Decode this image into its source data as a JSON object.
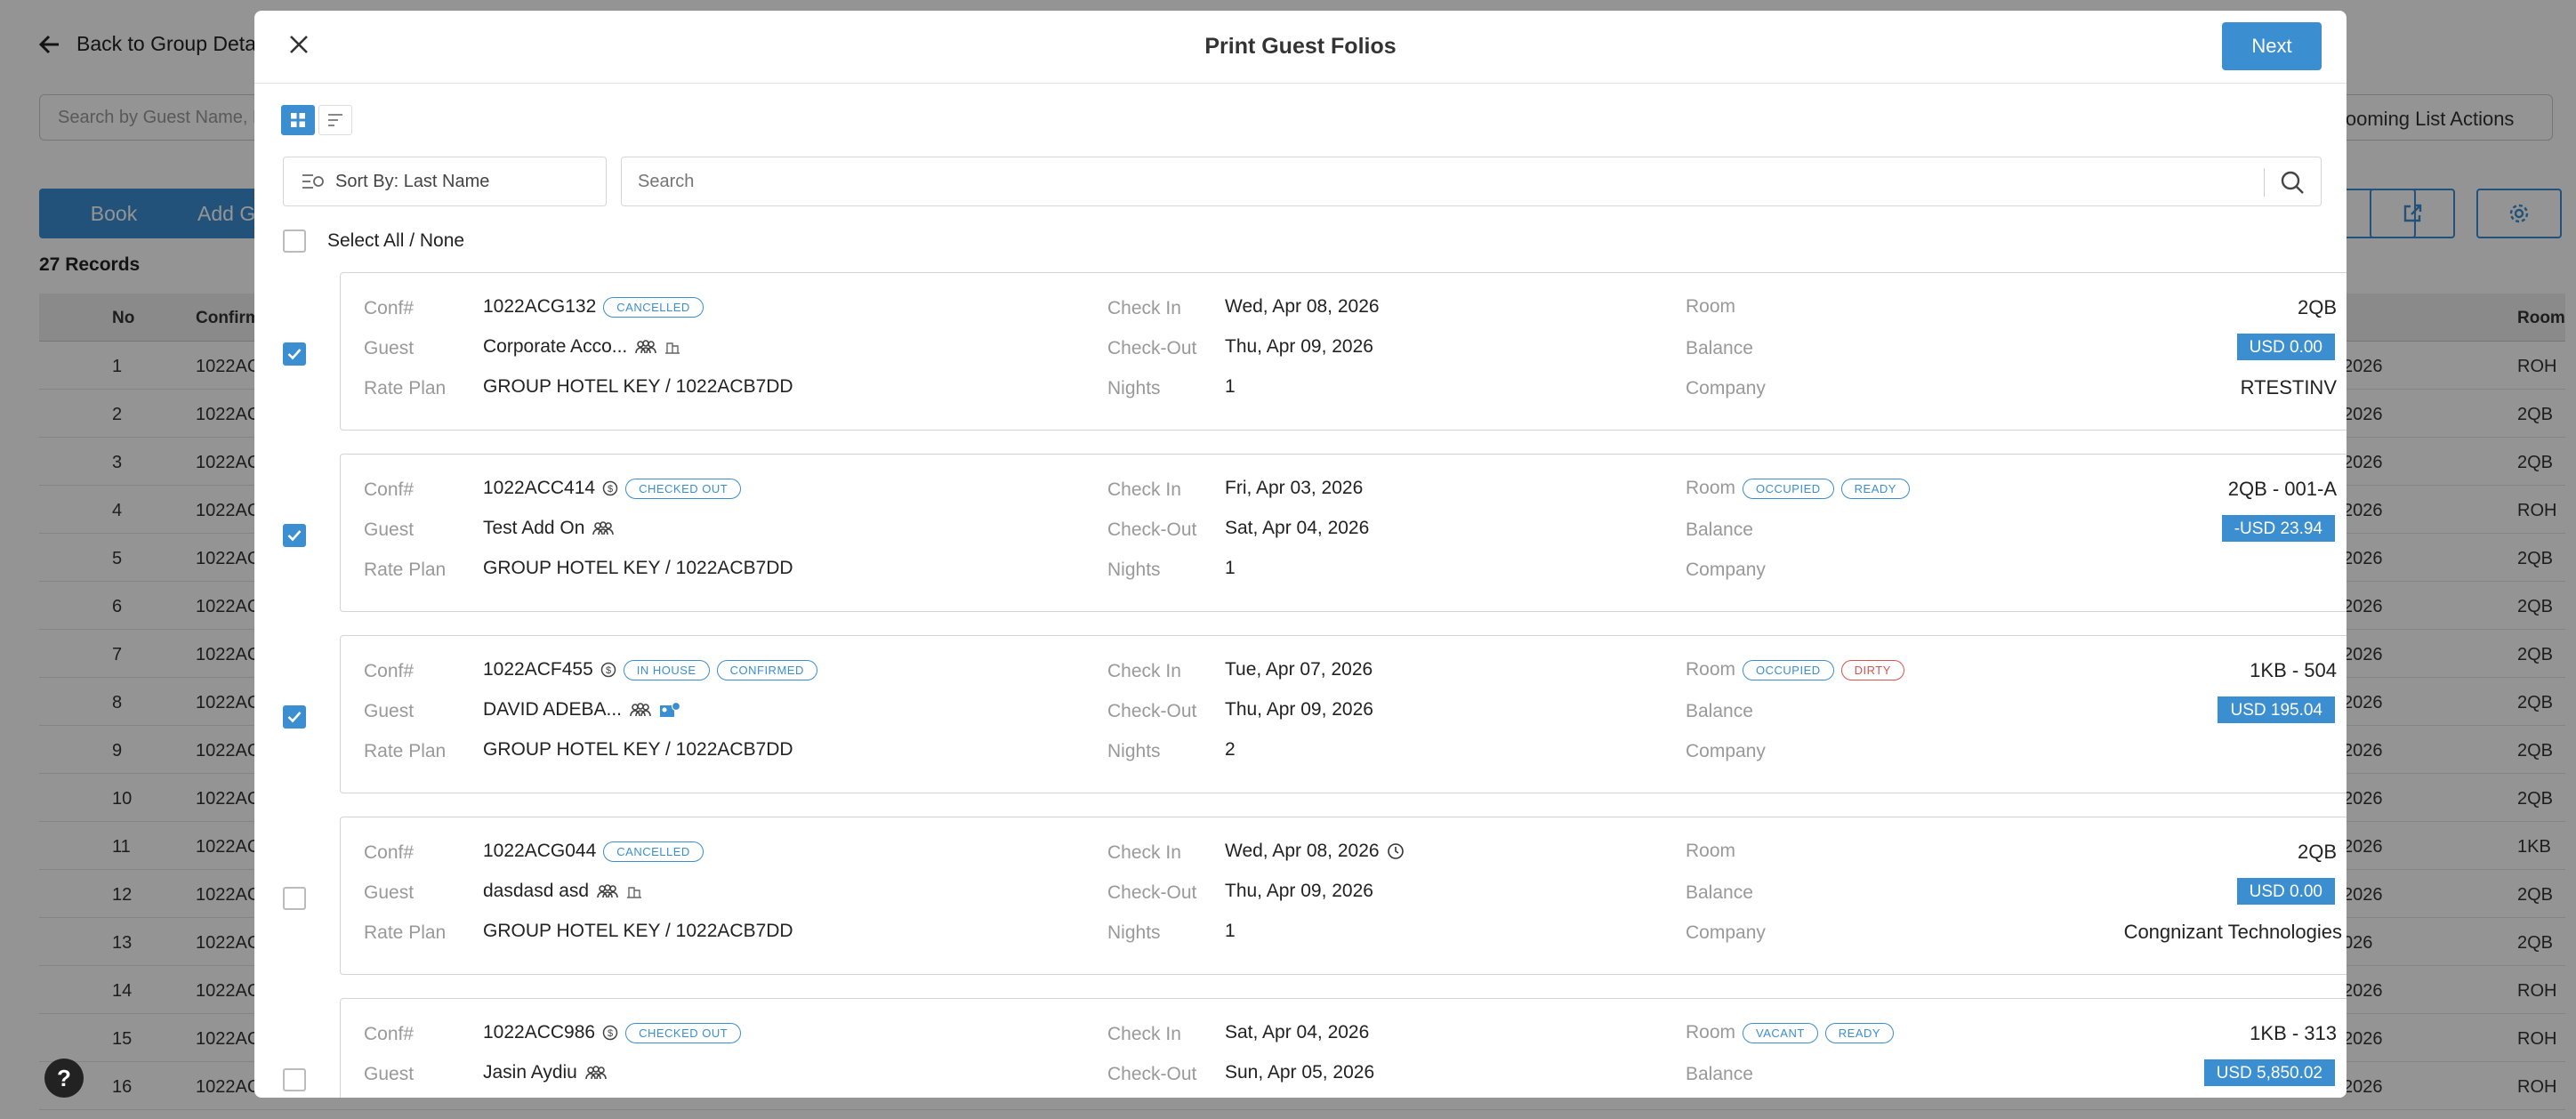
{
  "background": {
    "back_label": "Back to Group Details",
    "search_placeholder": "Search by Guest Name, Re",
    "rooming_actions_label": "Rooming List Actions",
    "book_label": "Book",
    "add_label": "Add G",
    "records_label": "27 Records",
    "columns": [
      "No",
      "Confirm",
      "",
      "Room"
    ],
    "rows": [
      {
        "no": "1",
        "conf": "1022AC",
        "date": "2026",
        "room": "ROH"
      },
      {
        "no": "2",
        "conf": "1022AC",
        "date": "2026",
        "room": "2QB"
      },
      {
        "no": "3",
        "conf": "1022AC",
        "date": "2026",
        "room": "2QB"
      },
      {
        "no": "4",
        "conf": "1022AC",
        "date": "2026",
        "room": "ROH"
      },
      {
        "no": "5",
        "conf": "1022AC",
        "date": "2026",
        "room": "2QB"
      },
      {
        "no": "6",
        "conf": "1022AC",
        "date": "2026",
        "room": "2QB"
      },
      {
        "no": "7",
        "conf": "1022AC",
        "date": "2026",
        "room": "2QB"
      },
      {
        "no": "8",
        "conf": "1022AC",
        "date": "2026",
        "room": "2QB"
      },
      {
        "no": "9",
        "conf": "1022AC",
        "date": "2026",
        "room": "2QB"
      },
      {
        "no": "10",
        "conf": "1022AC",
        "date": "2026",
        "room": "2QB"
      },
      {
        "no": "11",
        "conf": "1022AC",
        "date": "2026",
        "room": "1KB"
      },
      {
        "no": "12",
        "conf": "1022AC",
        "date": "2026",
        "room": "2QB"
      },
      {
        "no": "13",
        "conf": "1022AC",
        "date": "026",
        "room": "2QB"
      },
      {
        "no": "14",
        "conf": "1022AC",
        "date": "2026",
        "room": "ROH"
      },
      {
        "no": "15",
        "conf": "1022AC",
        "date": "2026",
        "room": "ROH"
      },
      {
        "no": "16",
        "conf": "1022AC",
        "date": "2026",
        "room": "ROH"
      }
    ],
    "help_label": "?"
  },
  "modal": {
    "title": "Print Guest Folios",
    "next_label": "Next",
    "sort_label": "Sort By: Last Name",
    "search_placeholder": "Search",
    "select_all_label": "Select All / None",
    "labels": {
      "conf": "Conf#",
      "guest": "Guest",
      "rate_plan": "Rate Plan",
      "check_in": "Check In",
      "check_out": "Check-Out",
      "nights": "Nights",
      "room": "Room",
      "balance": "Balance",
      "company": "Company"
    },
    "folios": [
      {
        "checked": true,
        "conf": "1022ACG132",
        "conf_badges": [
          "CANCELLED"
        ],
        "guest": "Corporate Acco...",
        "rate_plan": "GROUP HOTEL KEY / 1022ACB7DD",
        "check_in": "Wed, Apr 08, 2026",
        "check_out": "Thu, Apr 09, 2026",
        "nights": "1",
        "room_badges": [],
        "room": "2QB",
        "balance": "USD 0.00",
        "company": "RTESTINV"
      },
      {
        "checked": true,
        "conf": "1022ACC414",
        "conf_badges": [
          "CHECKED OUT"
        ],
        "guest": "Test Add On",
        "rate_plan": "GROUP HOTEL KEY / 1022ACB7DD",
        "check_in": "Fri, Apr 03, 2026",
        "check_out": "Sat, Apr 04, 2026",
        "nights": "1",
        "room_badges": [
          "OCCUPIED",
          "READY"
        ],
        "room": "2QB - 001-A",
        "balance": "-USD 23.94",
        "company": ""
      },
      {
        "checked": true,
        "conf": "1022ACF455",
        "conf_badges": [
          "IN HOUSE",
          "CONFIRMED"
        ],
        "guest": "DAVID ADEBA...",
        "rate_plan": "GROUP HOTEL KEY / 1022ACB7DD",
        "check_in": "Tue, Apr 07, 2026",
        "check_out": "Thu, Apr 09, 2026",
        "nights": "2",
        "room_badges": [
          "OCCUPIED",
          "DIRTY"
        ],
        "room": "1KB - 504",
        "balance": "USD 195.04",
        "company": ""
      },
      {
        "checked": false,
        "conf": "1022ACG044",
        "conf_badges": [
          "CANCELLED"
        ],
        "guest": "dasdasd asd",
        "rate_plan": "GROUP HOTEL KEY / 1022ACB7DD",
        "check_in": "Wed, Apr 08, 2026",
        "check_out": "Thu, Apr 09, 2026",
        "nights": "1",
        "room_badges": [],
        "room": "2QB",
        "balance": "USD 0.00",
        "company": "Congnizant Technologies"
      },
      {
        "checked": false,
        "conf": "1022ACC986",
        "conf_badges": [
          "CHECKED OUT"
        ],
        "guest": "Jasin Aydiu",
        "rate_plan": "",
        "check_in": "Sat, Apr 04, 2026",
        "check_out": "Sun, Apr 05, 2026",
        "nights": "",
        "room_badges": [
          "VACANT",
          "READY"
        ],
        "room": "1KB - 313",
        "balance": "USD 5,850.02",
        "company": ""
      }
    ]
  },
  "colors": {
    "accent": "#3b8ed0",
    "danger": "#d9534f",
    "overlay": "rgba(0,0,0,0.42)"
  }
}
